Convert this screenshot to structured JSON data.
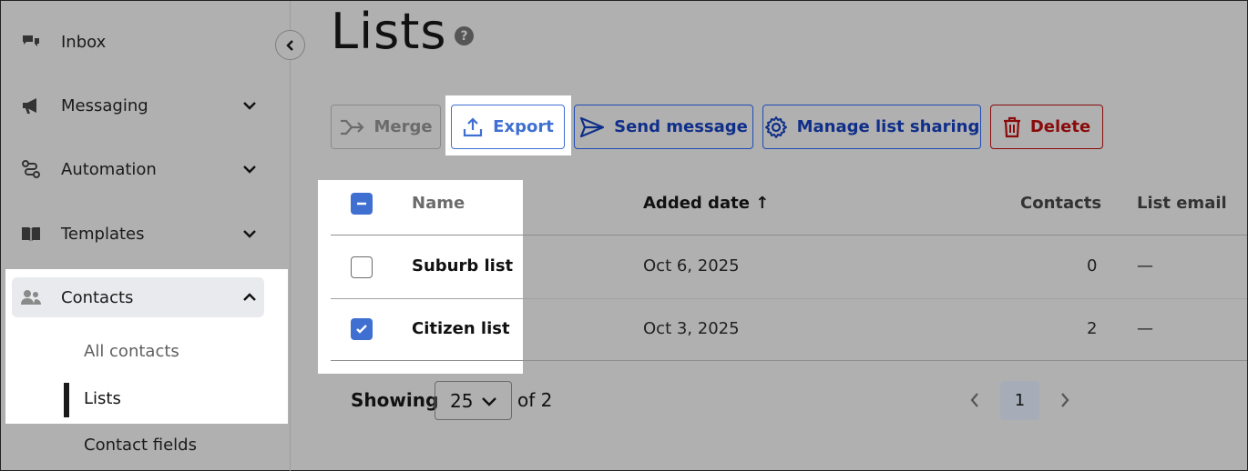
{
  "sidebar": {
    "items": [
      {
        "label": "Inbox",
        "icon": "chat-bubbles-icon"
      },
      {
        "label": "Messaging",
        "icon": "megaphone-icon"
      },
      {
        "label": "Automation",
        "icon": "workflow-icon"
      },
      {
        "label": "Templates",
        "icon": "book-icon"
      },
      {
        "label": "Contacts",
        "icon": "people-icon"
      }
    ],
    "sub_items": [
      "All contacts",
      "Lists",
      "Contact fields"
    ]
  },
  "page": {
    "title": "Lists",
    "help": "?"
  },
  "toolbar": {
    "merge": "Merge",
    "export": "Export",
    "send": "Send message",
    "share": "Manage list sharing",
    "delete": "Delete"
  },
  "table": {
    "headers": {
      "name": "Name",
      "added": "Added date",
      "added_sort": "↑",
      "contacts": "Contacts",
      "email": "List email"
    },
    "rows": [
      {
        "name": "Suburb list",
        "added": "Oct 6, 2025",
        "contacts": "0",
        "email": "—",
        "checked": false
      },
      {
        "name": "Citizen list",
        "added": "Oct 3, 2025",
        "contacts": "2",
        "email": "—",
        "checked": true
      }
    ]
  },
  "footer": {
    "showing": "Showing",
    "page_size": "25",
    "of": "of 2",
    "current_page": "1"
  },
  "colors": {
    "accent_blue": "#1f4bb5",
    "checkbox_blue": "#3f6fd1",
    "delete_red": "#8b0b0b",
    "highlight": "#ffffff"
  }
}
